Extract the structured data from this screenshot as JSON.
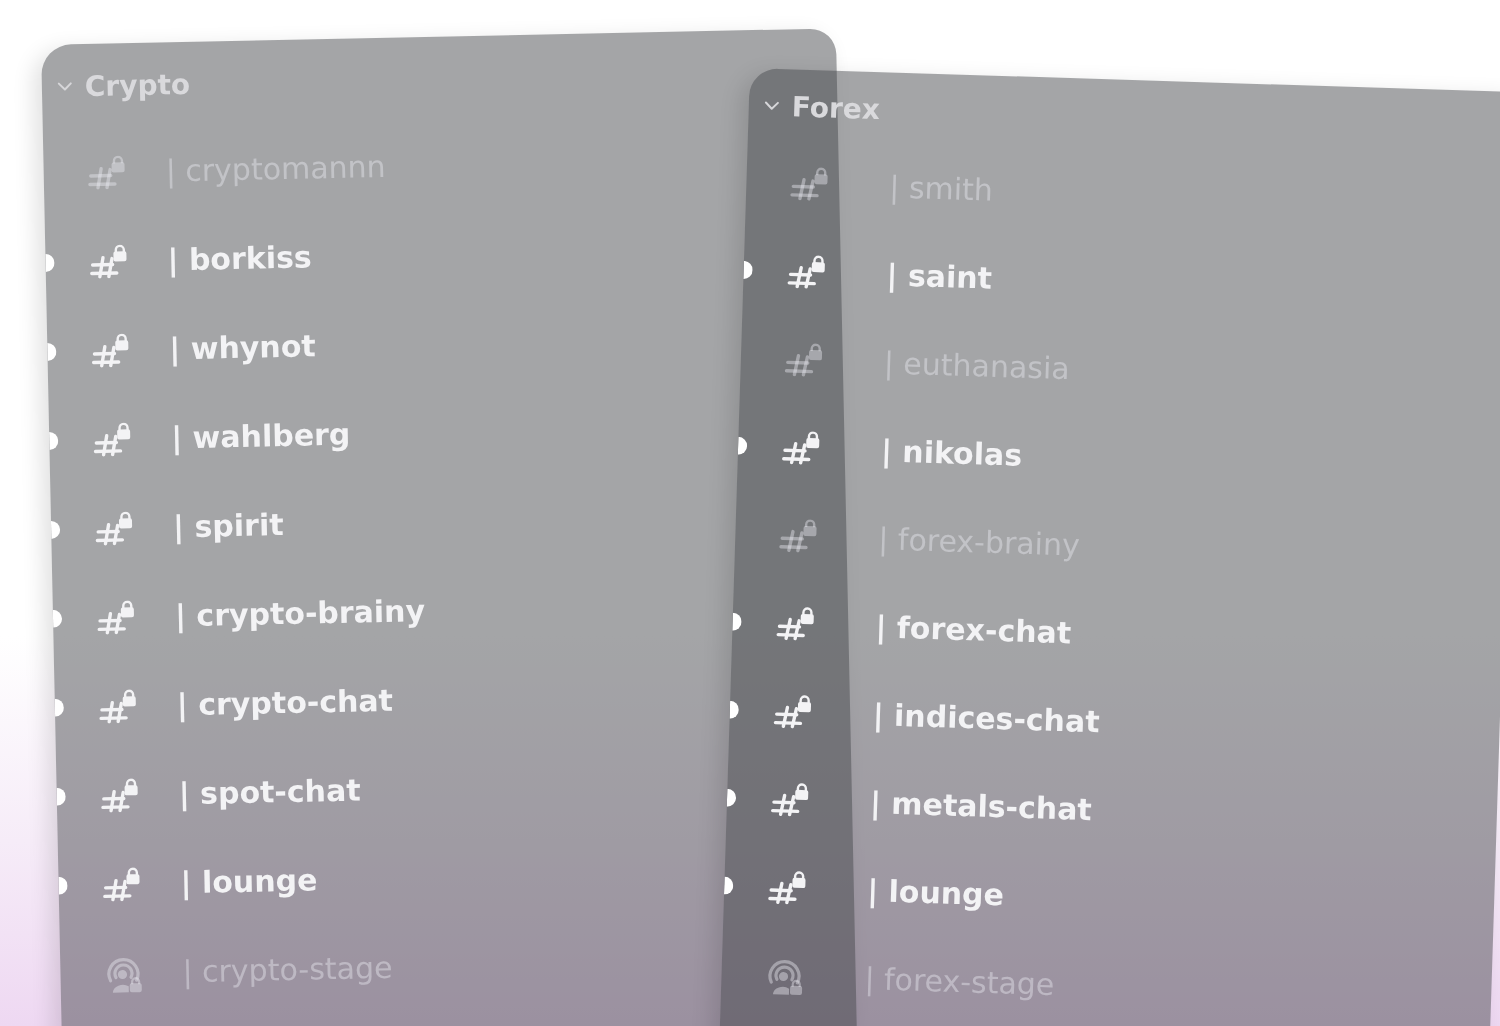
{
  "categories": [
    {
      "name": "Crypto",
      "expanded": true,
      "channels": [
        {
          "kind": "text",
          "name": "| cryptomannn",
          "locked": true,
          "unread": false
        },
        {
          "kind": "text",
          "name": "| borkiss",
          "locked": true,
          "unread": true
        },
        {
          "kind": "text",
          "name": "| whynot",
          "locked": true,
          "unread": true
        },
        {
          "kind": "text",
          "name": "| wahlberg",
          "locked": true,
          "unread": true
        },
        {
          "kind": "text",
          "name": "| spirit",
          "locked": true,
          "unread": true
        },
        {
          "kind": "text",
          "name": "| crypto-brainy",
          "locked": true,
          "unread": true
        },
        {
          "kind": "text",
          "name": "| crypto-chat",
          "locked": true,
          "unread": true
        },
        {
          "kind": "text",
          "name": "| spot-chat",
          "locked": true,
          "unread": true
        },
        {
          "kind": "text",
          "name": "| lounge",
          "locked": true,
          "unread": true
        },
        {
          "kind": "stage",
          "name": "| crypto-stage",
          "locked": true,
          "unread": false
        }
      ]
    },
    {
      "name": "Forex",
      "expanded": true,
      "channels": [
        {
          "kind": "text",
          "name": "| smith",
          "locked": true,
          "unread": false
        },
        {
          "kind": "text",
          "name": "| saint",
          "locked": true,
          "unread": true
        },
        {
          "kind": "text",
          "name": "| euthanasia",
          "locked": true,
          "unread": false
        },
        {
          "kind": "text",
          "name": "| nikolas",
          "locked": true,
          "unread": true
        },
        {
          "kind": "text",
          "name": "| forex-brainy",
          "locked": true,
          "unread": false
        },
        {
          "kind": "text",
          "name": "| forex-chat",
          "locked": true,
          "unread": true
        },
        {
          "kind": "text",
          "name": "| indices-chat",
          "locked": true,
          "unread": true
        },
        {
          "kind": "text",
          "name": "| metals-chat",
          "locked": true,
          "unread": true
        },
        {
          "kind": "text",
          "name": "| lounge",
          "locked": true,
          "unread": true
        },
        {
          "kind": "stage",
          "name": "| forex-stage",
          "locked": true,
          "unread": false
        }
      ]
    }
  ]
}
